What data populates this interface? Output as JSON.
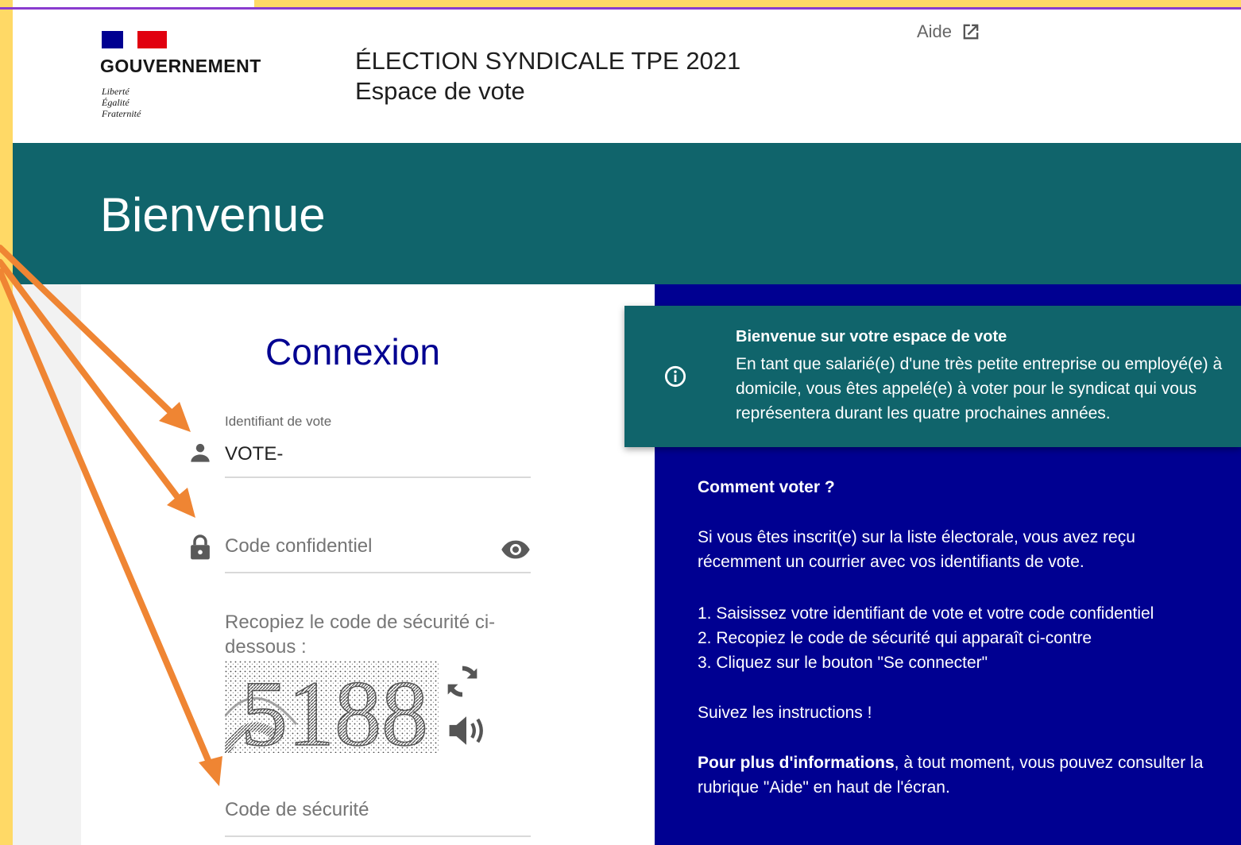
{
  "header": {
    "gov_name": "GOUVERNEMENT",
    "motto": [
      "Liberté",
      "Égalité",
      "Fraternité"
    ],
    "site_title": "ÉLECTION SYNDICALE TPE 2021",
    "site_subtitle": "Espace de vote",
    "help_label": "Aide",
    "help_icon": "external-link-icon"
  },
  "banner": {
    "title": "Bienvenue"
  },
  "login": {
    "title": "Connexion",
    "id_label": "Identifiant de vote",
    "id_value": "VOTE-",
    "password_placeholder": "Code confidentiel",
    "captcha_instruction": "Recopiez le code de sécurité ci-dessous :",
    "captcha_code": "5188",
    "security_placeholder": "Code de sécurité"
  },
  "info_box": {
    "title": "Bienvenue sur votre espace de vote",
    "text": "En tant que salarié(e) d'une très petite entreprise ou employé(e) à domicile, vous êtes appelé(e) à voter pour le syndicat qui vous représentera durant les quatre prochaines années."
  },
  "instructions": {
    "how_title": "Comment voter ?",
    "intro": "Si vous êtes inscrit(e) sur la liste électorale, vous avez reçu récemment un courrier avec vos identifiants de vote.",
    "steps": [
      "1. Saisissez votre identifiant de vote et votre code confidentiel",
      "2. Recopiez le code de sécurité qui apparaît ci-contre",
      "3. Cliquez sur le bouton \"Se connecter\""
    ],
    "follow": "Suivez les instructions !",
    "more_bold": "Pour plus d'informations",
    "more_rest": ", à tout moment, vous pouvez consulter la rubrique \"Aide\" en haut de l'écran."
  },
  "colors": {
    "teal": "#10646b",
    "navy": "#000091",
    "annotation_orange": "#ef8533",
    "frame_yellow": "#ffd966"
  }
}
